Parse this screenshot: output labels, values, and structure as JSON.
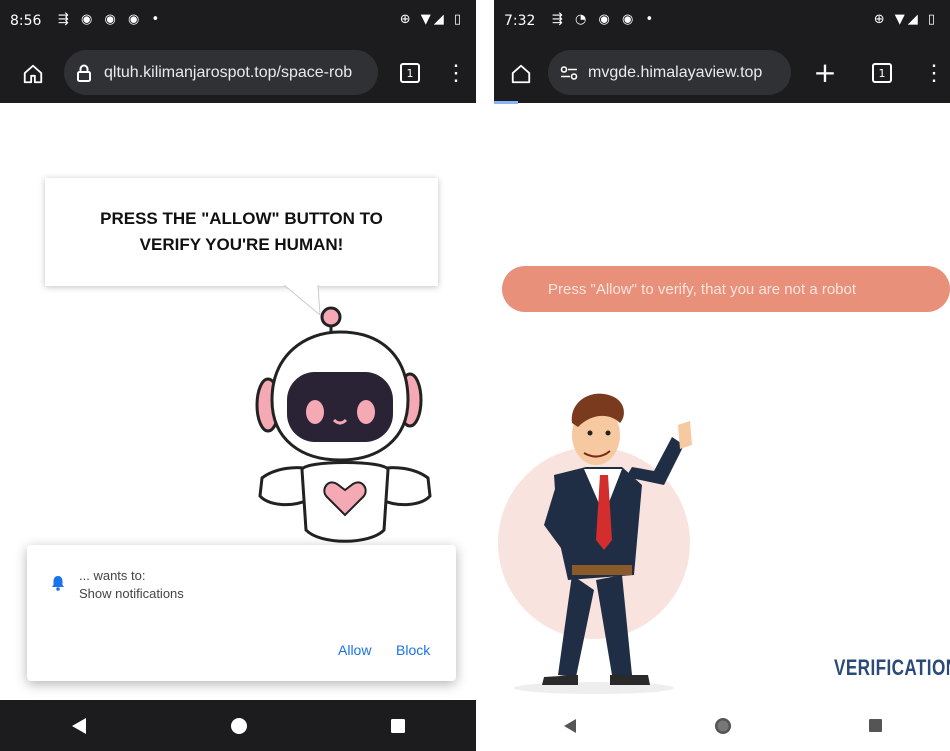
{
  "left": {
    "status": {
      "time": "8:56",
      "icons": "⇶ ◉ ◉ ◉ •",
      "right_icons": "⊕ ▼◢ ▯"
    },
    "urlbar": {
      "url": "qltuh.kilimanjarospot.top/space-rob",
      "tab_count": "1"
    },
    "bubble": {
      "line1": "PRESS THE \"ALLOW\" BUTTON TO",
      "line2": "VERIFY YOU'RE HUMAN!"
    },
    "dialog": {
      "wants": "... wants to:",
      "permission": "Show notifications",
      "allow": "Allow",
      "block": "Block"
    }
  },
  "right": {
    "status": {
      "time": "7:32",
      "icons": "⇶ ◔ ◉ ◉ •",
      "right_icons": "⊕ ▼◢ ▯"
    },
    "urlbar": {
      "url": "mvgde.himalayaview.top",
      "tab_count": "1"
    },
    "banner": "Press \"Allow\" to verify, that you are not a robot",
    "verification": "VERIFICATION"
  },
  "colors": {
    "accent_blue": "#1a73e8",
    "salmon": "#e8907a",
    "navy": "#2a4b78",
    "chrome_dark": "#1c1c1e"
  }
}
